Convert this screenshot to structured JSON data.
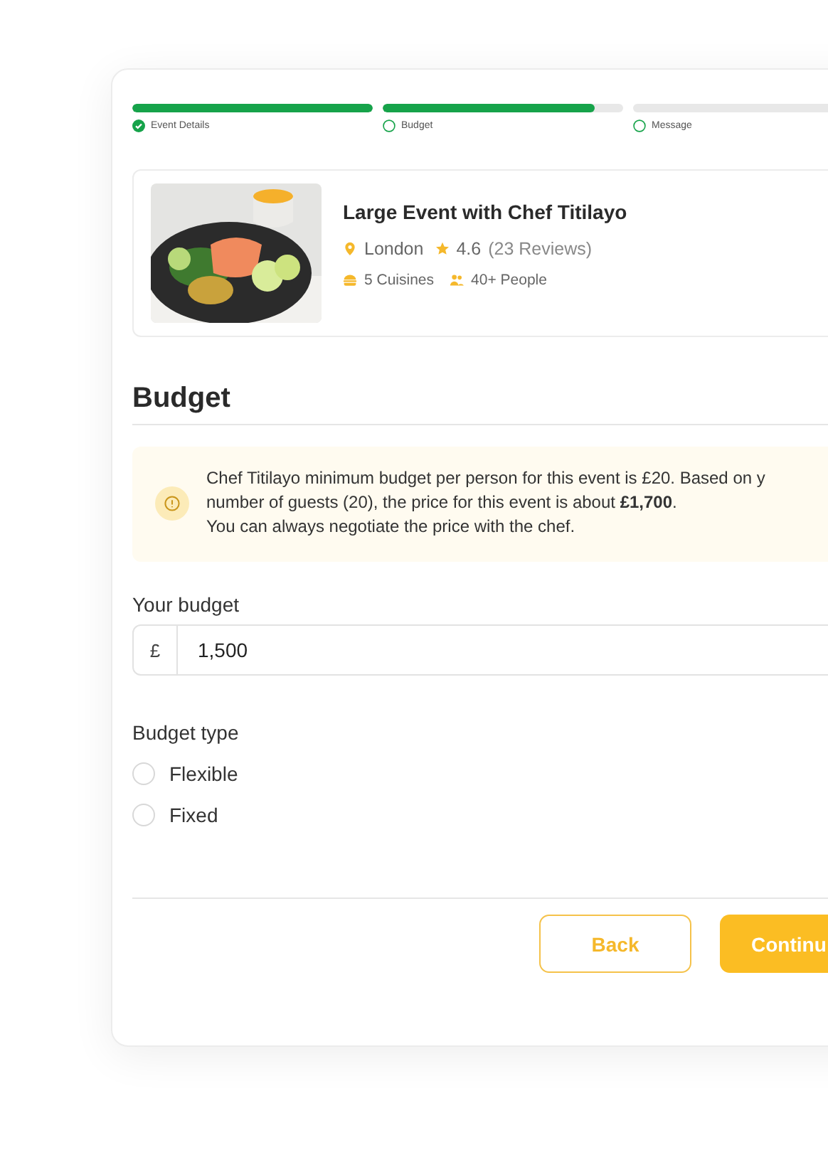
{
  "steps": [
    {
      "label": "Event Details",
      "level": 1,
      "done": true
    },
    {
      "label": "Budget",
      "level": 0.88,
      "done": false
    },
    {
      "label": "Message",
      "level": 0,
      "done": false
    }
  ],
  "event": {
    "kind": "picture",
    "title": "Large Event with Chef Titilayo",
    "location": "London",
    "rating": "4.6",
    "reviews": "(23 Reviews)",
    "cuisines": "5 Cuisines",
    "people": "40+ People"
  },
  "heading": "Budget",
  "info": [
    "Chef Titilayo minimum budget per person for this event is £20. Based on y",
    "number of guests (20), the price for this event is about **£1,700**.",
    "You can always negotiate the price with the chef."
  ],
  "budget": {
    "label": "Your budget",
    "prefix": "£",
    "value": "1,500"
  },
  "budget_type": {
    "label": "Budget type",
    "options": [
      {
        "label": "Flexible",
        "selected": false
      },
      {
        "label": "Fixed",
        "selected": false
      }
    ]
  },
  "buttons": [
    {
      "label": "Back",
      "kind": "secondary"
    },
    {
      "label": "Continu",
      "kind": "primary"
    }
  ]
}
